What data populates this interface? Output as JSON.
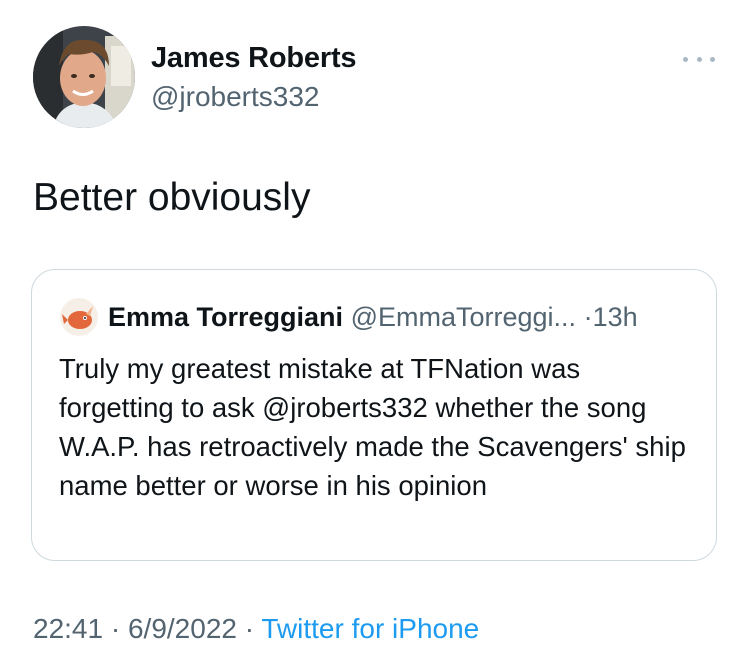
{
  "author": {
    "name": "James Roberts",
    "handle": "@jroberts332"
  },
  "tweet": {
    "text": "Better obviously"
  },
  "quoted_tweet": {
    "name": "Emma Torreggiani",
    "handle": "@EmmaTorreggi...",
    "separator": "·",
    "time": "13h",
    "text": "Truly my greatest mistake at TFNation was forgetting to ask @jroberts332 whether the song W.A.P. has retroactively made the Scavengers' ship name better or worse in his opinion"
  },
  "meta": {
    "time": "22:41",
    "sep1": "·",
    "date": "6/9/2022",
    "sep2": "·",
    "source": "Twitter for iPhone"
  },
  "colors": {
    "text": "#0f1419",
    "secondary": "#536471",
    "link": "#1d9bf0",
    "border": "#cfd9de"
  },
  "icons": {
    "more": "more-horizontal-icon"
  }
}
